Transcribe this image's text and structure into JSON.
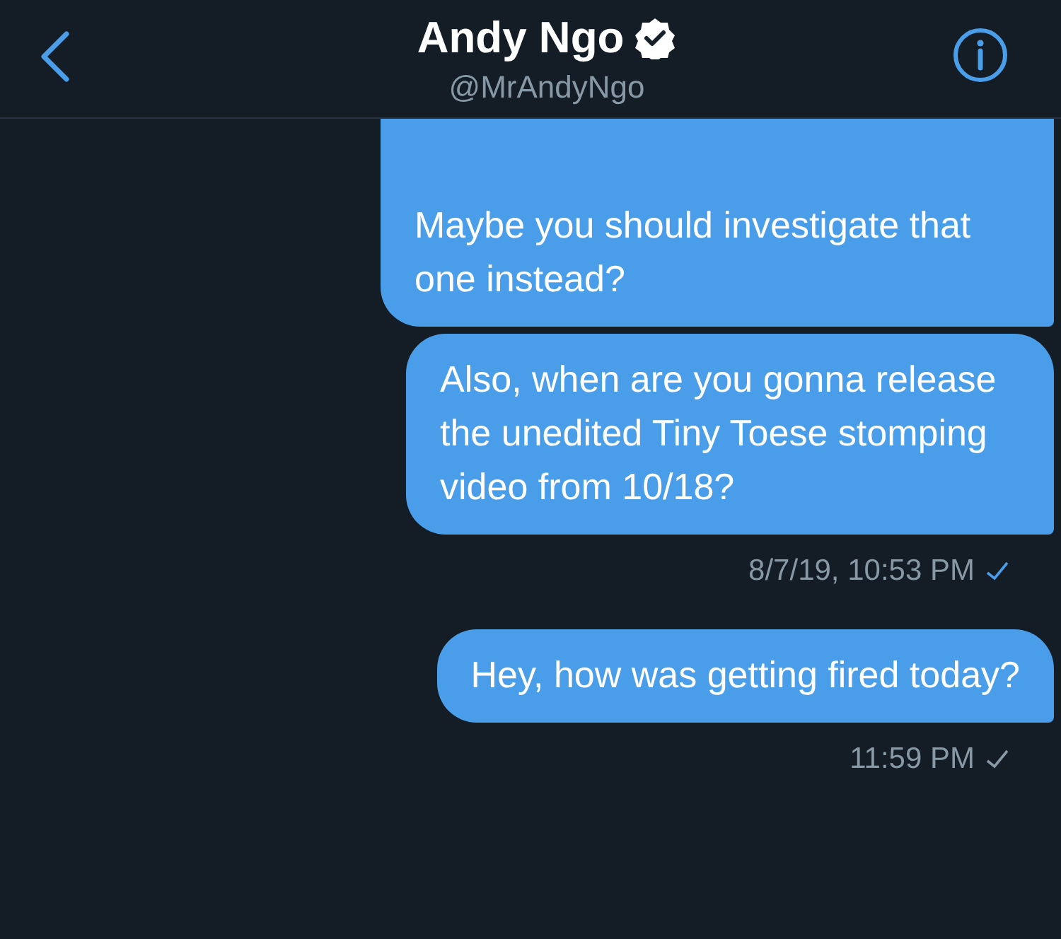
{
  "header": {
    "name": "Andy Ngo",
    "verified": true,
    "handle": "@MrAndyNgo"
  },
  "messages": [
    {
      "kind": "bubble",
      "text": "Maybe you should investigate that one instead?",
      "clipped_top": true
    },
    {
      "kind": "bubble",
      "text": "Also, when are you gonna release the unedited Tiny Toese stomping video from 10/18?",
      "clipped_top": false
    },
    {
      "kind": "timestamp",
      "text": "8/7/19, 10:53 PM",
      "read": true
    },
    {
      "kind": "bubble",
      "text": "Hey, how was getting fired today?",
      "clipped_top": false
    },
    {
      "kind": "timestamp",
      "text": "11:59 PM",
      "read": false
    }
  ]
}
